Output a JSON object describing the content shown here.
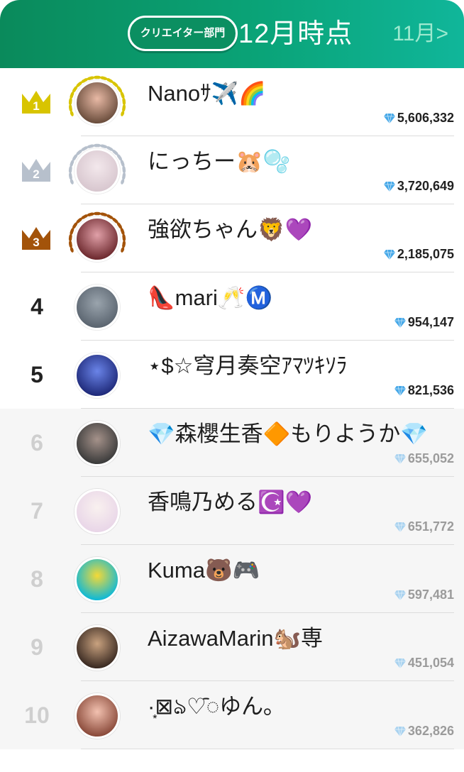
{
  "header": {
    "category_label": "クリエイター部門",
    "period_label": "12月時点",
    "prev_month_label": "11月>"
  },
  "colors": {
    "header_green": "#0a8a5b",
    "gold": "#d8c400",
    "silver": "#b7c0cc",
    "bronze": "#a3530a"
  },
  "ranking": [
    {
      "rank": "1",
      "name": "Nanoｻ✈️🌈",
      "score": "5,606,332",
      "avatar_colors": [
        "#6b4e3d",
        "#e8b9a5"
      ],
      "wreath": "gold"
    },
    {
      "rank": "2",
      "name": "にっちー🐹🫧",
      "score": "3,720,649",
      "avatar_colors": [
        "#d8c7cf",
        "#f3e8ec"
      ],
      "wreath": "silver"
    },
    {
      "rank": "3",
      "name": "強欲ちゃん🦁💜",
      "score": "2,185,075",
      "avatar_colors": [
        "#6e2a2f",
        "#e0a0a8"
      ],
      "wreath": "bronze"
    },
    {
      "rank": "4",
      "name": "👠mari🥂Ⓜ️",
      "score": "954,147",
      "avatar_colors": [
        "#5b6570",
        "#9aa4ad"
      ]
    },
    {
      "rank": "5",
      "name": "⋆$☆穹月奏空ｱﾏﾂｷｿﾗ",
      "score": "821,536",
      "avatar_colors": [
        "#1f2a7a",
        "#6a84e8"
      ]
    },
    {
      "rank": "6",
      "name": "💎森櫻生香🔶もりようか💎",
      "score": "655,052",
      "avatar_colors": [
        "#3b3b3b",
        "#a5928a"
      ]
    },
    {
      "rank": "7",
      "name": "香鳴乃める☪️💜",
      "score": "651,772",
      "avatar_colors": [
        "#e9d6e8",
        "#f9f1ef"
      ]
    },
    {
      "rank": "8",
      "name": "Kuma🐻🎮",
      "score": "597,481",
      "avatar_colors": [
        "#0fb9d6",
        "#f5d936"
      ]
    },
    {
      "rank": "9",
      "name": "AizawaMarin🐿️専",
      "score": "451,054",
      "avatar_colors": [
        "#3a2a22",
        "#c9a27f"
      ]
    },
    {
      "rank": "10",
      "name": "·͙⊠ঌ♡ᯩゆん｡",
      "score": "362,826",
      "avatar_colors": [
        "#8a4a3a",
        "#f2c1b0"
      ]
    }
  ]
}
